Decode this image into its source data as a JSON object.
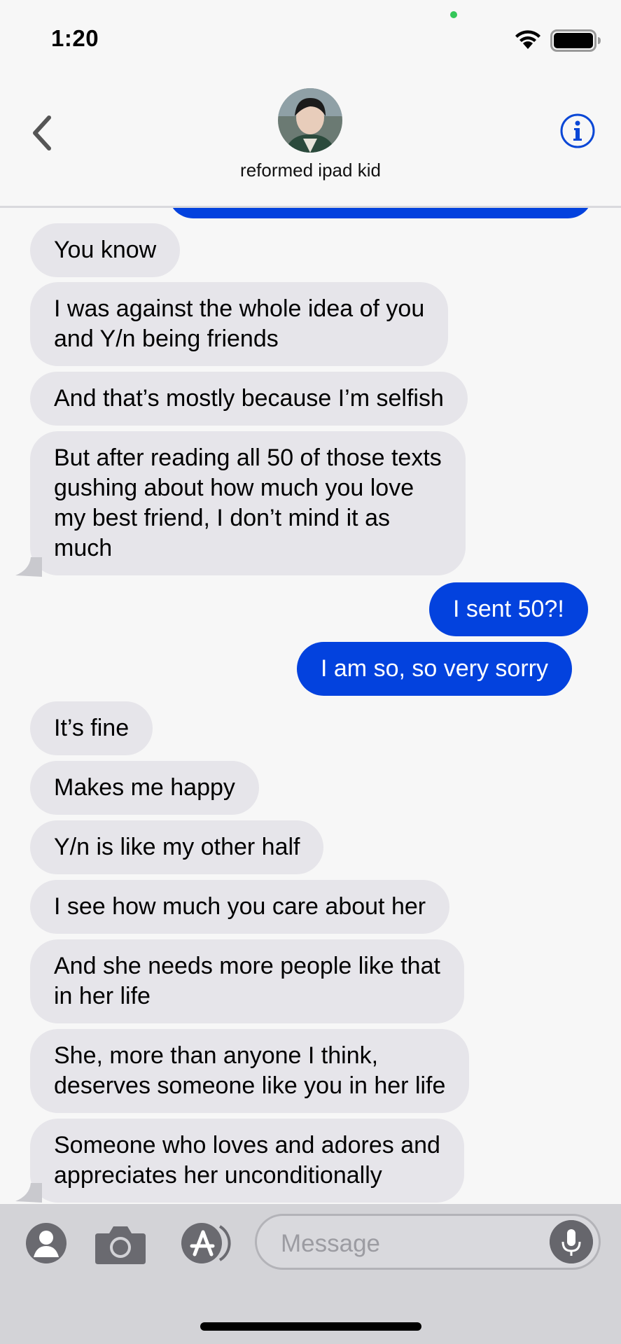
{
  "status": {
    "time": "1:20"
  },
  "header": {
    "contact_name": "reformed ipad kid"
  },
  "messages": [
    {
      "dir": "in",
      "text": "You know"
    },
    {
      "dir": "in",
      "text": "I was against the whole idea of you\nand Y/n being friends"
    },
    {
      "dir": "in",
      "text": "And that’s mostly because I’m selfish"
    },
    {
      "dir": "in",
      "text": "But after reading all 50 of those texts\ngushing about how much you love\nmy best friend, I don’t mind it as\nmuch"
    },
    {
      "dir": "out",
      "text": "I sent 50?!"
    },
    {
      "dir": "out",
      "text": "I am so, so very sorry"
    },
    {
      "dir": "in",
      "text": "It’s fine"
    },
    {
      "dir": "in",
      "text": "Makes me happy"
    },
    {
      "dir": "in",
      "text": "Y/n is like my other half"
    },
    {
      "dir": "in",
      "text": "I see how much you care about her"
    },
    {
      "dir": "in",
      "text": "And she needs more people like that\nin her life"
    },
    {
      "dir": "in",
      "text": "She, more than anyone I think,\ndeserves someone like you in her life"
    },
    {
      "dir": "in",
      "text": "Someone who loves and adores and\nappreciates her unconditionally"
    }
  ],
  "composer": {
    "placeholder": "Message"
  },
  "colors": {
    "outgoing": "#0342de",
    "incoming": "#e6e5ea",
    "accent": "#0a47d6"
  },
  "icons": [
    "back-chevron-icon",
    "info-icon",
    "contact-icon",
    "camera-icon",
    "app-store-icon",
    "microphone-icon",
    "wifi-icon",
    "battery-icon"
  ]
}
